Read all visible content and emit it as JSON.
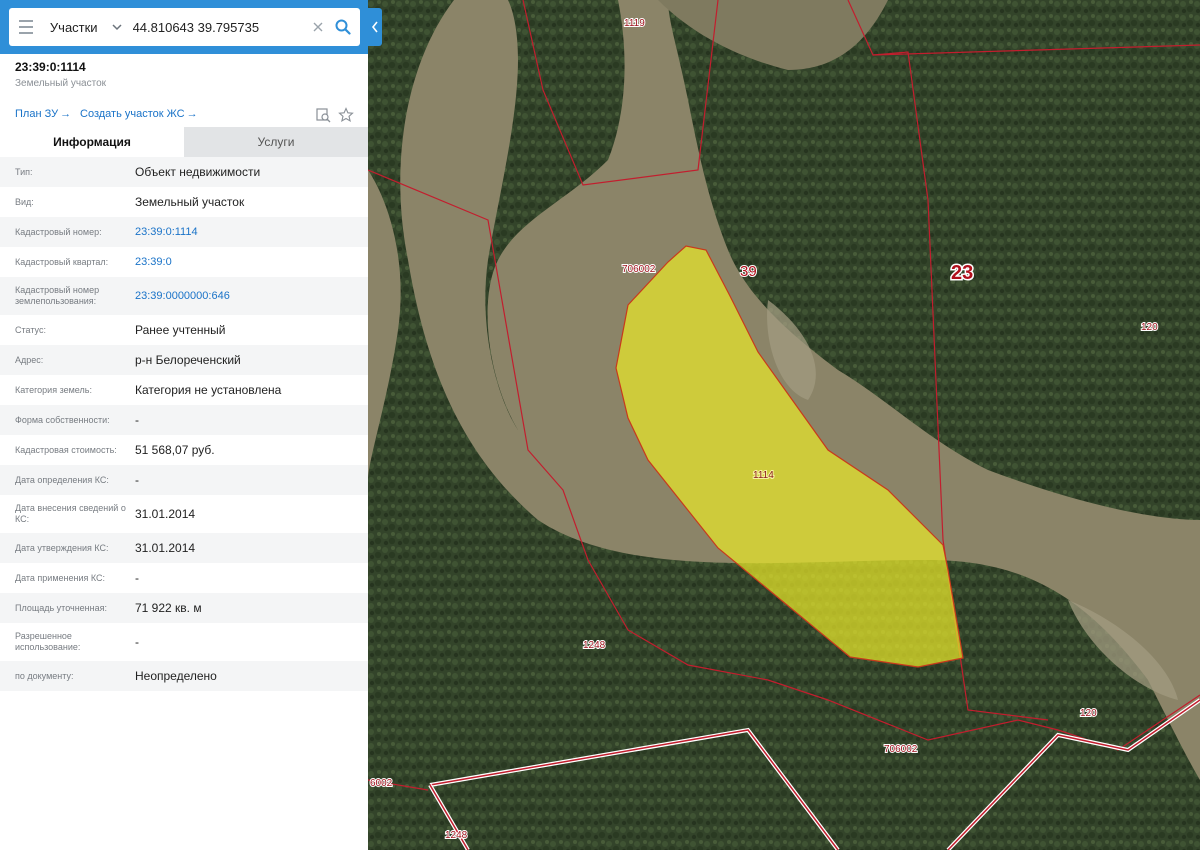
{
  "search": {
    "layer": "Участки",
    "value": "44.810643 39.795735"
  },
  "object": {
    "title": "23:39:0:1114",
    "subtitle": "Земельный участок"
  },
  "links": {
    "plan": "План ЗУ",
    "create": "Создать участок ЖС"
  },
  "tabs": [
    {
      "label": "Информация",
      "active": true
    },
    {
      "label": "Услуги",
      "active": false
    }
  ],
  "attributes": [
    {
      "key": "Тип:",
      "value": "Объект недвижимости",
      "link": false
    },
    {
      "key": "Вид:",
      "value": "Земельный участок",
      "link": false
    },
    {
      "key": "Кадастровый номер:",
      "value": "23:39:0:1114",
      "link": true
    },
    {
      "key": "Кадастровый квартал:",
      "value": "23:39:0",
      "link": true
    },
    {
      "key": "Кадастровый номер землепользования:",
      "value": "23:39:0000000:646",
      "link": true
    },
    {
      "key": "Статус:",
      "value": "Ранее учтенный",
      "link": false
    },
    {
      "key": "Адрес:",
      "value": "р-н Белореченский",
      "link": false
    },
    {
      "key": "Категория земель:",
      "value": "Категория не установлена",
      "link": false
    },
    {
      "key": "Форма собственности:",
      "value": "-",
      "link": false
    },
    {
      "key": "Кадастровая стоимость:",
      "value": "51 568,07 руб.",
      "link": false
    },
    {
      "key": "Дата определения КС:",
      "value": "-",
      "link": false
    },
    {
      "key": "Дата внесения сведений о КС:",
      "value": "31.01.2014",
      "link": false
    },
    {
      "key": "Дата утверждения КС:",
      "value": "31.01.2014",
      "link": false
    },
    {
      "key": "Дата применения КС:",
      "value": "-",
      "link": false
    },
    {
      "key": "Площадь уточненная:",
      "value": "71 922 кв. м",
      "link": false
    },
    {
      "key": "Разрешенное использование:",
      "value": "-",
      "link": false
    },
    {
      "key": "по документу:",
      "value": "Неопределено",
      "link": false
    }
  ],
  "map": {
    "labels": {
      "parcel_1114": "1114",
      "parcel_1119": "1119",
      "quarter_706002_a": "706002",
      "quarter_706002_b": "706002",
      "quarter_6002": "6002",
      "district_39": "39",
      "region_23": "23",
      "parcel_120_a": "120",
      "parcel_120_b": "120",
      "parcel_1248_a": "1248",
      "parcel_1248_b": "1248"
    },
    "colors": {
      "forest": "#34452a",
      "river": "#8b8468",
      "sand": "#9c9880",
      "boundary": "#c21e2e",
      "selection_fill": "#e8e62a",
      "selection_stroke": "#c83a1c",
      "accent": "#2f8fd8"
    }
  }
}
